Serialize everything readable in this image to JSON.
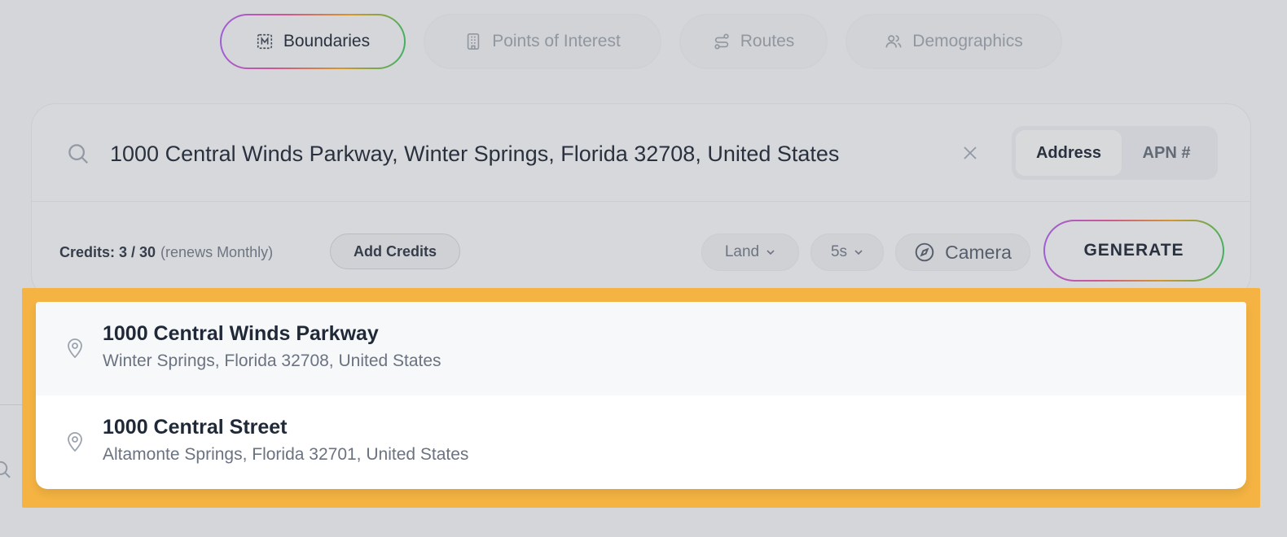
{
  "tabs": [
    {
      "label": "Boundaries",
      "icon": "boundary-icon",
      "active": true
    },
    {
      "label": "Points of Interest",
      "icon": "building-icon",
      "active": false
    },
    {
      "label": "Routes",
      "icon": "route-icon",
      "active": false
    },
    {
      "label": "Demographics",
      "icon": "people-icon",
      "active": false
    }
  ],
  "search": {
    "value": "1000 Central Winds Parkway, Winter Springs, Florida 32708, United States",
    "mode_options": [
      "Address",
      "APN #"
    ],
    "mode_selected": "Address"
  },
  "controls": {
    "credits_label": "Credits: 3 / 30",
    "credits_renew": "(renews Monthly)",
    "add_credits": "Add Credits",
    "land_select": "Land",
    "duration_select": "5s",
    "camera": "Camera",
    "generate": "GENERATE"
  },
  "suggestions": [
    {
      "title": "1000 Central Winds Parkway",
      "subtitle": "Winter Springs, Florida 32708, United States"
    },
    {
      "title": "1000 Central Street",
      "subtitle": "Altamonte Springs, Florida 32701, United States"
    }
  ],
  "colors": {
    "highlight": "#f4b342",
    "gradient": [
      "#a855f7",
      "#ec4899",
      "#f59e0b",
      "#22c55e"
    ]
  }
}
